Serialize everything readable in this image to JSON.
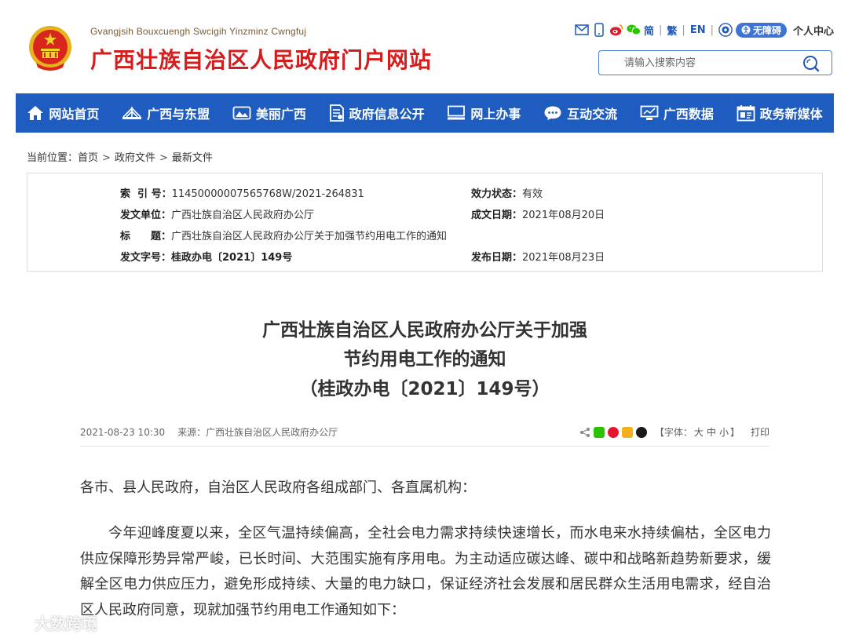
{
  "header": {
    "site_name_en": "Gvangjsih Bouxcuengh Swcigih Yinzminz Cwngfuj",
    "site_name_cn": "广西壮族自治区人民政府门户网站",
    "lang_simplified": "简",
    "lang_traditional": "繁",
    "lang_en": "EN",
    "accessibility_label": "无障碍",
    "user_center": "个人中心",
    "search_placeholder": "请输入搜索内容"
  },
  "nav": [
    {
      "label": "网站首页",
      "icon": "home-icon"
    },
    {
      "label": "广西与东盟",
      "icon": "bridge-icon"
    },
    {
      "label": "美丽广西",
      "icon": "landscape-icon"
    },
    {
      "label": "政府信息公开",
      "icon": "document-icon"
    },
    {
      "label": "网上办事",
      "icon": "monitor-keyboard-icon"
    },
    {
      "label": "互动交流",
      "icon": "chat-bubble-icon"
    },
    {
      "label": "广西数据",
      "icon": "screen-chart-icon"
    },
    {
      "label": "政务新媒体",
      "icon": "calendar-media-icon"
    }
  ],
  "breadcrumb": {
    "prefix": "当前位置：",
    "items": [
      "首页",
      "政府文件",
      "最新文件"
    ]
  },
  "meta": {
    "index_label": "索  引 号：",
    "index_value": "11450000007565768W/2021-264831",
    "status_label": "效力状态：",
    "status_value": "有效",
    "issuer_label": "发文单位：",
    "issuer_value": "广西壮族自治区人民政府办公厅",
    "date_made_label": "成文日期：",
    "date_made_value": "2021年08月20日",
    "title_label": "标　　题：",
    "title_value": "广西壮族自治区人民政府办公厅关于加强节约用电工作的通知",
    "doc_no_label": "发文字号：",
    "doc_no_value": "桂政办电〔2021〕149号",
    "pub_date_label": "发布日期：",
    "pub_date_value": "2021年08月23日"
  },
  "article": {
    "title_line1": "广西壮族自治区人民政府办公厅关于加强",
    "title_line2": "节约用电工作的通知",
    "title_line3": "（桂政办电〔2021〕149号）",
    "datetime": "2021-08-23 10:30",
    "source": "来源：广西壮族自治区人民政府办公厅",
    "font_label_open": "【字体：",
    "font_large": "大",
    "font_medium": "中",
    "font_small": "小",
    "font_label_close": "】",
    "print": "打印",
    "salutation": "各市、县人民政府，自治区人民政府各组成部门、各直属机构：",
    "paragraph1": "今年迎峰度夏以来，全区气温持续偏高，全社会电力需求持续快速增长，而水电来水持续偏枯，全区电力供应保障形势异常严峻，已长时间、大范围实施有序用电。为主动适应碳达峰、碳中和战略新趋势新要求，缓解全区电力供应压力，避免形成持续、大量的电力缺口，保证经济社会发展和居民群众生活用电需求，经自治区人民政府同意，现就加强节约用电工作通知如下："
  },
  "watermark": "大数跨境",
  "colors": {
    "nav_bg": "#1f5cbf",
    "site_title_red": "#d41d1d",
    "link_blue": "#1f58b8"
  }
}
